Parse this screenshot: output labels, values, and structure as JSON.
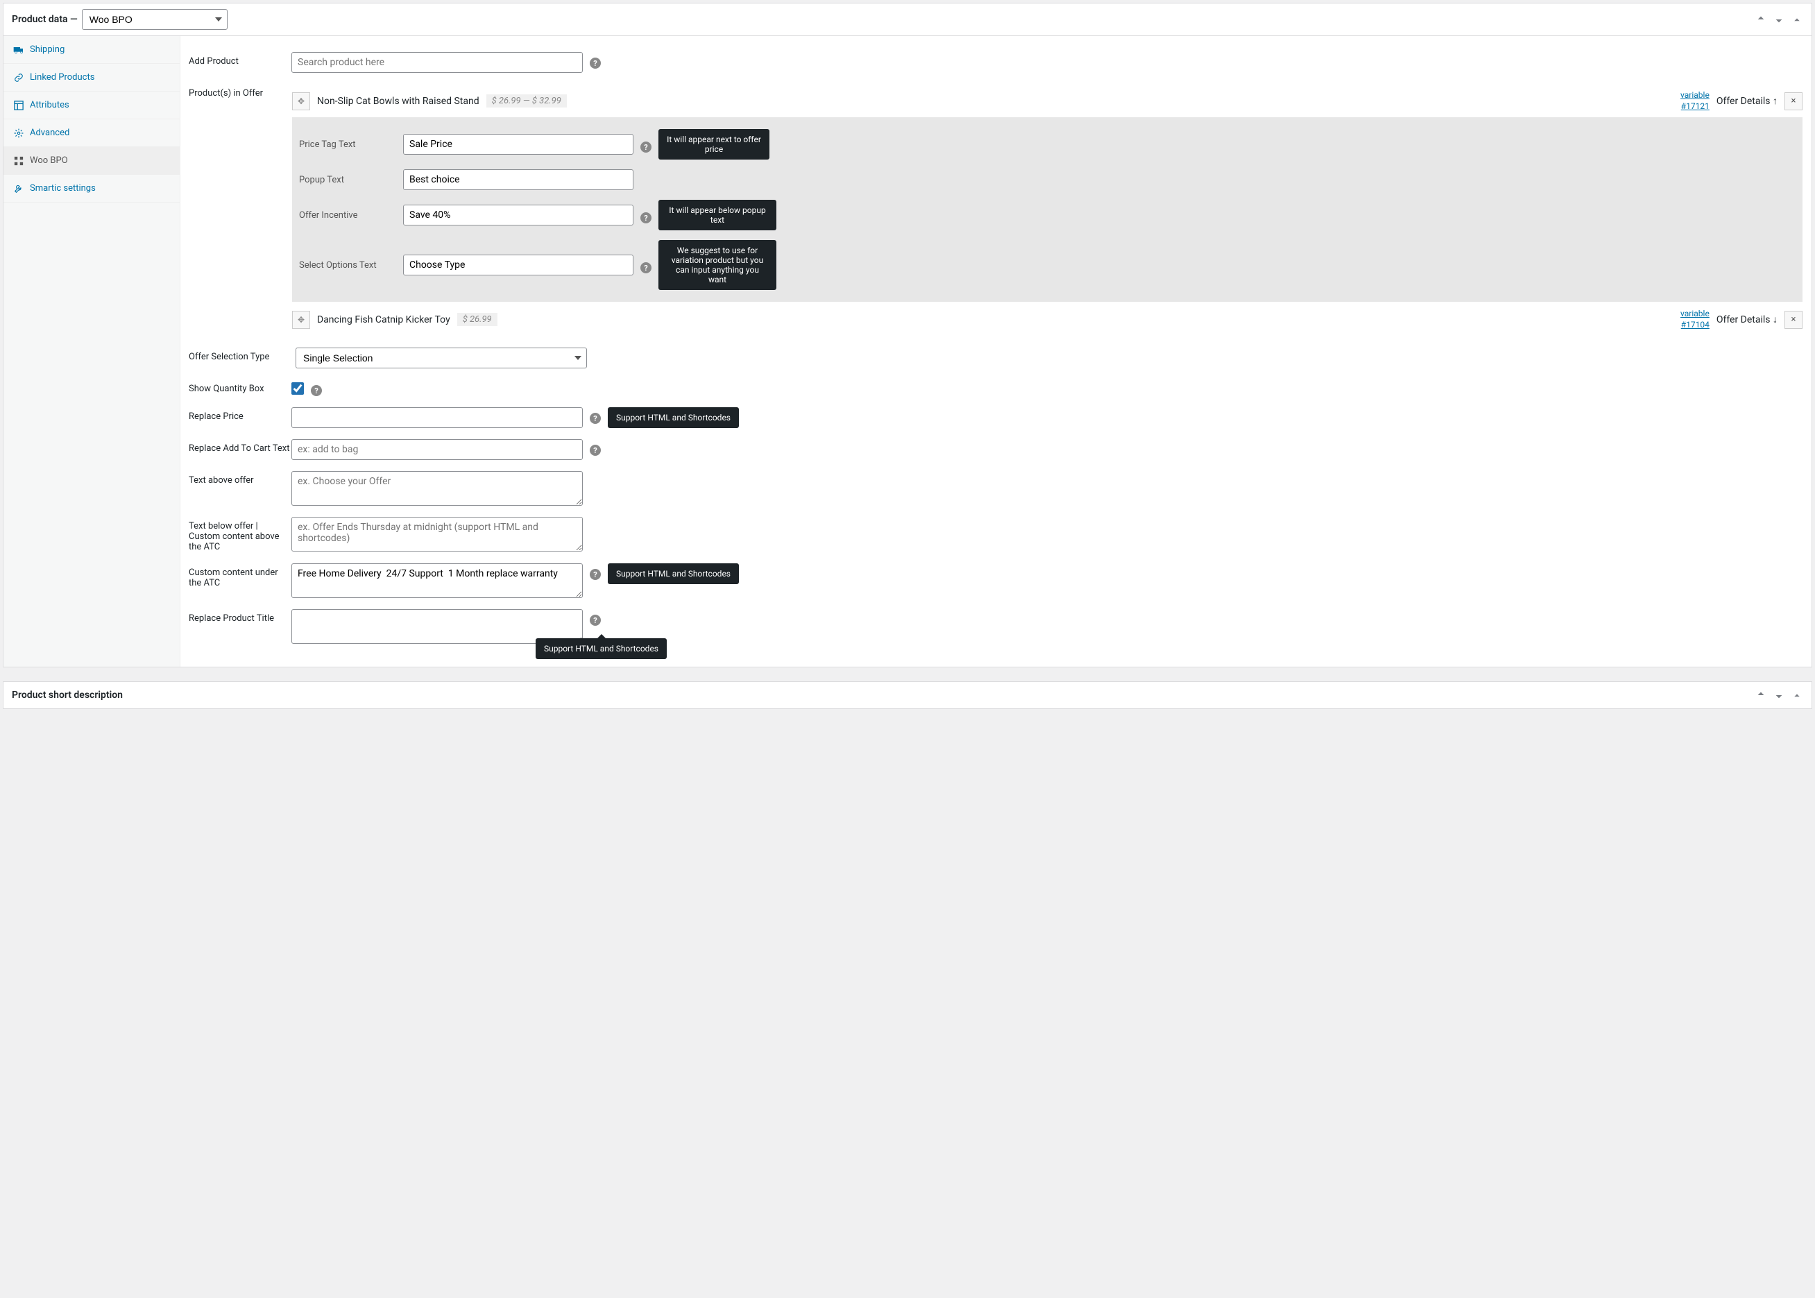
{
  "panel": {
    "title": "Product data —",
    "type_value": "Woo BPO"
  },
  "sidebar": {
    "items": [
      {
        "icon": "truck",
        "label": "Shipping"
      },
      {
        "icon": "link",
        "label": "Linked Products"
      },
      {
        "icon": "layout",
        "label": "Attributes"
      },
      {
        "icon": "gear",
        "label": "Advanced"
      },
      {
        "icon": "grid",
        "label": "Woo BPO"
      },
      {
        "icon": "wrench",
        "label": "Smartic settings"
      }
    ]
  },
  "labels": {
    "add_product": "Add Product",
    "products_in_offer": "Product(s) in Offer",
    "offer_selection_type": "Offer Selection Type",
    "show_quantity_box": "Show Quantity Box",
    "replace_price": "Replace Price",
    "replace_atc_text": "Replace Add To Cart Text",
    "text_above_offer": "Text above offer",
    "text_below_offer": "Text below offer | Custom content above the ATC",
    "custom_under_atc": "Custom content under the ATC",
    "replace_product_title": "Replace Product Title"
  },
  "placeholders": {
    "search_product": "Search product here",
    "replace_atc": "ex: add to bag",
    "text_above": "ex. Choose your Offer",
    "text_below": "ex. Offer Ends Thursday at midnight (support HTML and shortcodes)"
  },
  "values": {
    "offer_selection_type": "Single Selection",
    "custom_under_atc": "Free Home Delivery  24/7 Support  1 Month replace warranty",
    "replace_price": "",
    "replace_product_title": ""
  },
  "offers": [
    {
      "title": "Non-Slip Cat Bowls with Raised Stand",
      "price_display": "$ 26.99  —  $ 32.99",
      "link_type": "variable",
      "link_id": "#17121",
      "toggle_label": "Offer Details ↑",
      "expanded": true
    },
    {
      "title": "Dancing Fish Catnip Kicker Toy",
      "price_display": "$ 26.99",
      "link_type": "variable",
      "link_id": "#17104",
      "toggle_label": "Offer Details ↓",
      "expanded": false
    }
  ],
  "offer_detail_labels": {
    "price_tag": "Price Tag Text",
    "popup_text": "Popup Text",
    "offer_incentive": "Offer Incentive",
    "select_options": "Select Options Text"
  },
  "offer_detail_values": {
    "price_tag": "Sale Price",
    "popup_text": "Best choice",
    "offer_incentive": "Save 40%",
    "select_options": "Choose Type"
  },
  "tooltips": {
    "price_tag": "It will appear next to offer price",
    "offer_incentive": "It will appear below popup text",
    "select_options": "We suggest to use for variation product but you can input anything you want",
    "support_html_1": "Support HTML and Shortcodes",
    "support_html_2": "Support HTML and Shortcodes",
    "support_html_3": "Support HTML and Shortcodes"
  },
  "short_desc_title": "Product short description"
}
